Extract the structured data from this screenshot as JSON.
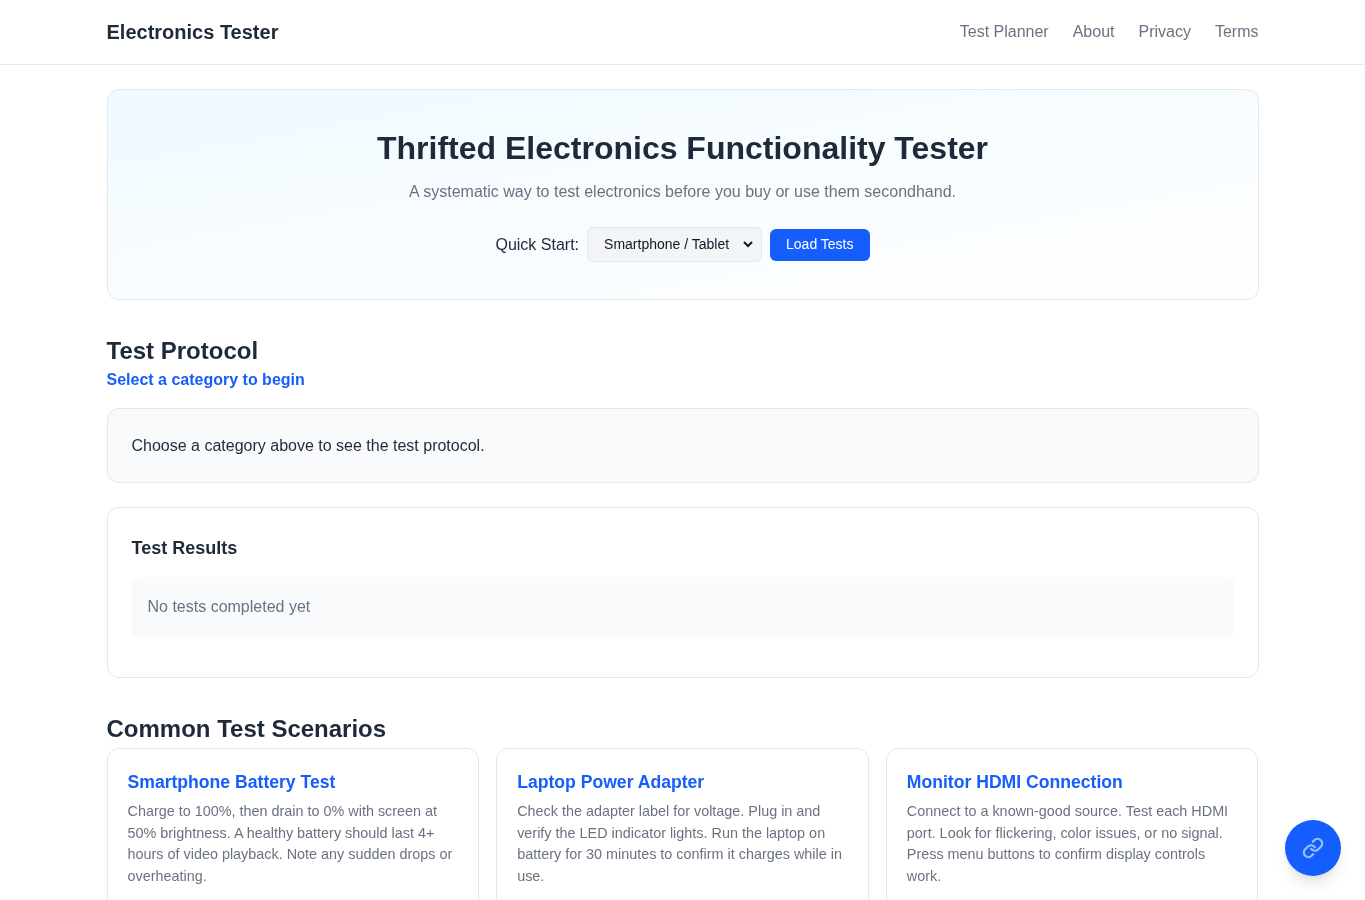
{
  "header": {
    "brand": "Electronics Tester",
    "nav": [
      "Test Planner",
      "About",
      "Privacy",
      "Terms"
    ]
  },
  "hero": {
    "title": "Thrifted Electronics Functionality Tester",
    "subtitle": "A systematic way to test electronics before you buy or use them secondhand.",
    "quick_start": {
      "label": "Quick Start:",
      "selected_option": "Smartphone / Tablet",
      "button": "Load Tests"
    }
  },
  "protocol": {
    "heading": "Test Protocol",
    "status": "Select a category to begin",
    "message": "Choose a category above to see the test protocol."
  },
  "results": {
    "heading": "Test Results",
    "empty_message": "No tests completed yet"
  },
  "scenarios": {
    "heading": "Common Test Scenarios",
    "cards": [
      {
        "title": "Smartphone Battery Test",
        "description": "Charge to 100%, then drain to 0% with screen at 50% brightness. A healthy battery should last 4+ hours of video playback. Note any sudden drops or overheating."
      },
      {
        "title": "Laptop Power Adapter",
        "description": "Check the adapter label for voltage. Plug in and verify the LED indicator lights. Run the laptop on battery for 30 minutes to confirm it charges while in use."
      },
      {
        "title": "Monitor HDMI Connection",
        "description": "Connect to a known-good source. Test each HDMI port. Look for flickering, color issues, or no signal. Press menu buttons to confirm display controls work."
      }
    ]
  }
}
